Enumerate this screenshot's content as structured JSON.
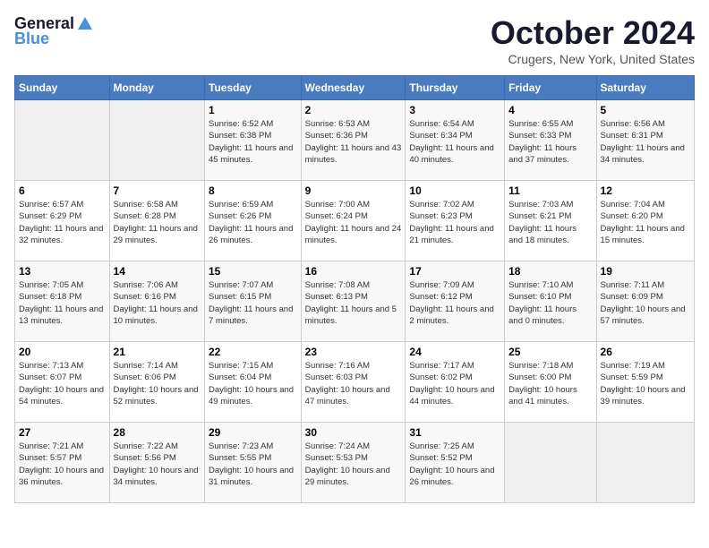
{
  "logo": {
    "general": "General",
    "blue": "Blue"
  },
  "title": "October 2024",
  "location": "Crugers, New York, United States",
  "days_of_week": [
    "Sunday",
    "Monday",
    "Tuesday",
    "Wednesday",
    "Thursday",
    "Friday",
    "Saturday"
  ],
  "weeks": [
    [
      {
        "day": "",
        "info": ""
      },
      {
        "day": "",
        "info": ""
      },
      {
        "day": "1",
        "info": "Sunrise: 6:52 AM\nSunset: 6:38 PM\nDaylight: 11 hours and 45 minutes."
      },
      {
        "day": "2",
        "info": "Sunrise: 6:53 AM\nSunset: 6:36 PM\nDaylight: 11 hours and 43 minutes."
      },
      {
        "day": "3",
        "info": "Sunrise: 6:54 AM\nSunset: 6:34 PM\nDaylight: 11 hours and 40 minutes."
      },
      {
        "day": "4",
        "info": "Sunrise: 6:55 AM\nSunset: 6:33 PM\nDaylight: 11 hours and 37 minutes."
      },
      {
        "day": "5",
        "info": "Sunrise: 6:56 AM\nSunset: 6:31 PM\nDaylight: 11 hours and 34 minutes."
      }
    ],
    [
      {
        "day": "6",
        "info": "Sunrise: 6:57 AM\nSunset: 6:29 PM\nDaylight: 11 hours and 32 minutes."
      },
      {
        "day": "7",
        "info": "Sunrise: 6:58 AM\nSunset: 6:28 PM\nDaylight: 11 hours and 29 minutes."
      },
      {
        "day": "8",
        "info": "Sunrise: 6:59 AM\nSunset: 6:26 PM\nDaylight: 11 hours and 26 minutes."
      },
      {
        "day": "9",
        "info": "Sunrise: 7:00 AM\nSunset: 6:24 PM\nDaylight: 11 hours and 24 minutes."
      },
      {
        "day": "10",
        "info": "Sunrise: 7:02 AM\nSunset: 6:23 PM\nDaylight: 11 hours and 21 minutes."
      },
      {
        "day": "11",
        "info": "Sunrise: 7:03 AM\nSunset: 6:21 PM\nDaylight: 11 hours and 18 minutes."
      },
      {
        "day": "12",
        "info": "Sunrise: 7:04 AM\nSunset: 6:20 PM\nDaylight: 11 hours and 15 minutes."
      }
    ],
    [
      {
        "day": "13",
        "info": "Sunrise: 7:05 AM\nSunset: 6:18 PM\nDaylight: 11 hours and 13 minutes."
      },
      {
        "day": "14",
        "info": "Sunrise: 7:06 AM\nSunset: 6:16 PM\nDaylight: 11 hours and 10 minutes."
      },
      {
        "day": "15",
        "info": "Sunrise: 7:07 AM\nSunset: 6:15 PM\nDaylight: 11 hours and 7 minutes."
      },
      {
        "day": "16",
        "info": "Sunrise: 7:08 AM\nSunset: 6:13 PM\nDaylight: 11 hours and 5 minutes."
      },
      {
        "day": "17",
        "info": "Sunrise: 7:09 AM\nSunset: 6:12 PM\nDaylight: 11 hours and 2 minutes."
      },
      {
        "day": "18",
        "info": "Sunrise: 7:10 AM\nSunset: 6:10 PM\nDaylight: 11 hours and 0 minutes."
      },
      {
        "day": "19",
        "info": "Sunrise: 7:11 AM\nSunset: 6:09 PM\nDaylight: 10 hours and 57 minutes."
      }
    ],
    [
      {
        "day": "20",
        "info": "Sunrise: 7:13 AM\nSunset: 6:07 PM\nDaylight: 10 hours and 54 minutes."
      },
      {
        "day": "21",
        "info": "Sunrise: 7:14 AM\nSunset: 6:06 PM\nDaylight: 10 hours and 52 minutes."
      },
      {
        "day": "22",
        "info": "Sunrise: 7:15 AM\nSunset: 6:04 PM\nDaylight: 10 hours and 49 minutes."
      },
      {
        "day": "23",
        "info": "Sunrise: 7:16 AM\nSunset: 6:03 PM\nDaylight: 10 hours and 47 minutes."
      },
      {
        "day": "24",
        "info": "Sunrise: 7:17 AM\nSunset: 6:02 PM\nDaylight: 10 hours and 44 minutes."
      },
      {
        "day": "25",
        "info": "Sunrise: 7:18 AM\nSunset: 6:00 PM\nDaylight: 10 hours and 41 minutes."
      },
      {
        "day": "26",
        "info": "Sunrise: 7:19 AM\nSunset: 5:59 PM\nDaylight: 10 hours and 39 minutes."
      }
    ],
    [
      {
        "day": "27",
        "info": "Sunrise: 7:21 AM\nSunset: 5:57 PM\nDaylight: 10 hours and 36 minutes."
      },
      {
        "day": "28",
        "info": "Sunrise: 7:22 AM\nSunset: 5:56 PM\nDaylight: 10 hours and 34 minutes."
      },
      {
        "day": "29",
        "info": "Sunrise: 7:23 AM\nSunset: 5:55 PM\nDaylight: 10 hours and 31 minutes."
      },
      {
        "day": "30",
        "info": "Sunrise: 7:24 AM\nSunset: 5:53 PM\nDaylight: 10 hours and 29 minutes."
      },
      {
        "day": "31",
        "info": "Sunrise: 7:25 AM\nSunset: 5:52 PM\nDaylight: 10 hours and 26 minutes."
      },
      {
        "day": "",
        "info": ""
      },
      {
        "day": "",
        "info": ""
      }
    ]
  ]
}
